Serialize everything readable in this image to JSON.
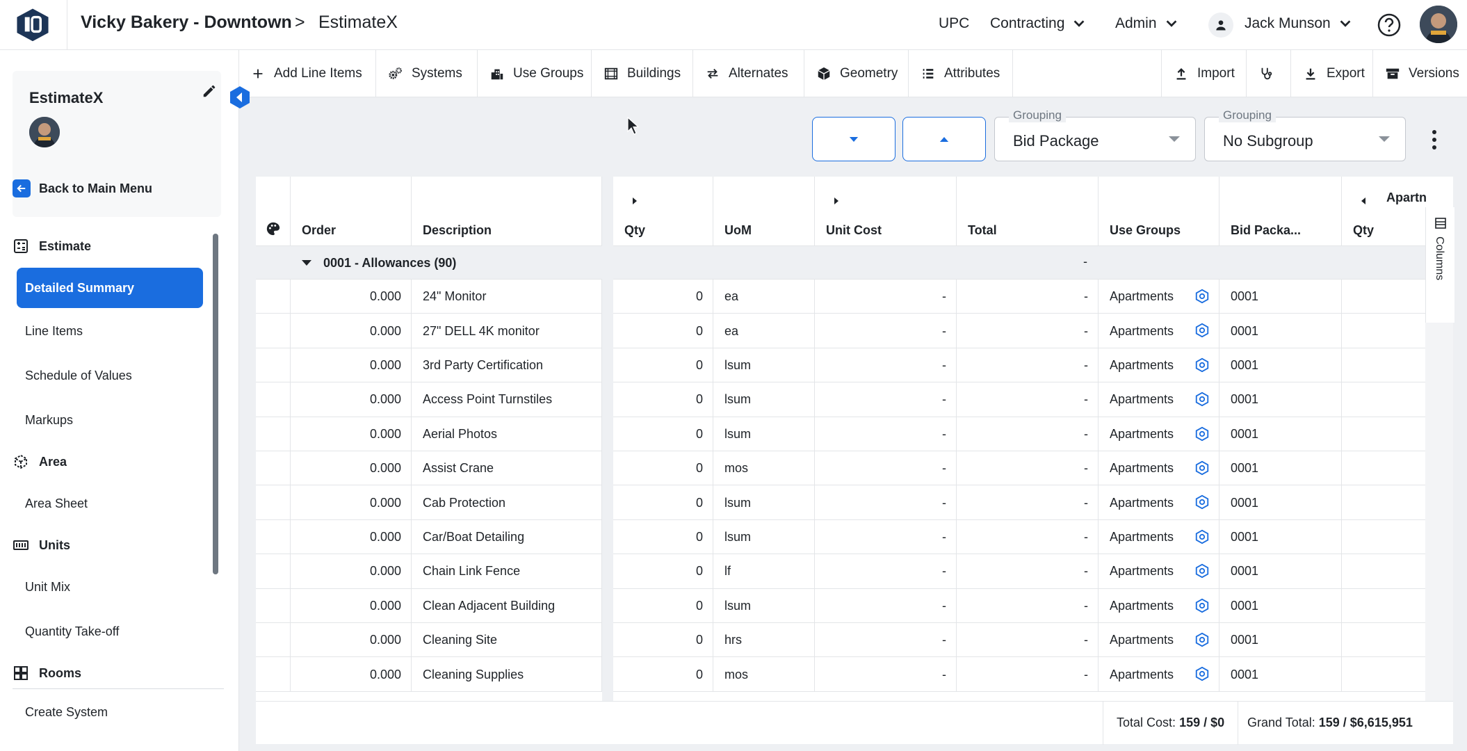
{
  "header": {
    "project_title": "Vicky Bakery - Downtown",
    "separator": ">",
    "page_title": "EstimateX",
    "nav": [
      {
        "label": "UPC"
      },
      {
        "label": "Contracting"
      },
      {
        "label": "Admin"
      }
    ],
    "user_name": "Jack Munson"
  },
  "sidebar": {
    "project_card_name": "EstimateX",
    "back_label": "Back to Main Menu",
    "sections": {
      "estimate": "Estimate",
      "area": "Area",
      "units": "Units",
      "rooms": "Rooms"
    },
    "items": {
      "detailed_summary": "Detailed Summary",
      "line_items": "Line Items",
      "schedule_of_values": "Schedule of Values",
      "markups": "Markups",
      "area_sheet": "Area Sheet",
      "unit_mix": "Unit Mix",
      "quantity_takeoff": "Quantity Take-off",
      "create_system": "Create System"
    }
  },
  "toolbar": {
    "add_line_items": "Add Line Items",
    "systems": "Systems",
    "use_groups": "Use Groups",
    "buildings": "Buildings",
    "alternates": "Alternates",
    "geometry": "Geometry",
    "attributes": "Attributes",
    "import": "Import",
    "export": "Export",
    "versions": "Versions"
  },
  "grouping": {
    "primary_label": "Grouping",
    "primary_value": "Bid Package",
    "secondary_label": "Grouping",
    "secondary_value": "No Subgroup"
  },
  "grid": {
    "columns": {
      "order": "Order",
      "description": "Description",
      "qty": "Qty",
      "uom": "UoM",
      "unit_cost": "Unit Cost",
      "total": "Total",
      "use_groups": "Use Groups",
      "bid_package": "Bid Packa...",
      "qty2": "Qty",
      "apartments_group": "Apartn"
    },
    "group_row": {
      "label": "0001 - Allowances (90)",
      "total": "-"
    },
    "rows": [
      {
        "order": "0.000",
        "description": "24\" Monitor",
        "qty": "0",
        "uom": "ea",
        "unit_cost": "-",
        "total": "-",
        "use_group": "Apartments",
        "bid_package": "0001"
      },
      {
        "order": "0.000",
        "description": "27\" DELL 4K monitor",
        "qty": "0",
        "uom": "ea",
        "unit_cost": "-",
        "total": "-",
        "use_group": "Apartments",
        "bid_package": "0001"
      },
      {
        "order": "0.000",
        "description": "3rd Party Certification",
        "qty": "0",
        "uom": "lsum",
        "unit_cost": "-",
        "total": "-",
        "use_group": "Apartments",
        "bid_package": "0001"
      },
      {
        "order": "0.000",
        "description": "Access Point Turnstiles",
        "qty": "0",
        "uom": "lsum",
        "unit_cost": "-",
        "total": "-",
        "use_group": "Apartments",
        "bid_package": "0001"
      },
      {
        "order": "0.000",
        "description": "Aerial Photos",
        "qty": "0",
        "uom": "lsum",
        "unit_cost": "-",
        "total": "-",
        "use_group": "Apartments",
        "bid_package": "0001"
      },
      {
        "order": "0.000",
        "description": "Assist Crane",
        "qty": "0",
        "uom": "mos",
        "unit_cost": "-",
        "total": "-",
        "use_group": "Apartments",
        "bid_package": "0001"
      },
      {
        "order": "0.000",
        "description": "Cab Protection",
        "qty": "0",
        "uom": "lsum",
        "unit_cost": "-",
        "total": "-",
        "use_group": "Apartments",
        "bid_package": "0001"
      },
      {
        "order": "0.000",
        "description": "Car/Boat Detailing",
        "qty": "0",
        "uom": "lsum",
        "unit_cost": "-",
        "total": "-",
        "use_group": "Apartments",
        "bid_package": "0001"
      },
      {
        "order": "0.000",
        "description": "Chain Link Fence",
        "qty": "0",
        "uom": "lf",
        "unit_cost": "-",
        "total": "-",
        "use_group": "Apartments",
        "bid_package": "0001"
      },
      {
        "order": "0.000",
        "description": "Clean Adjacent Building",
        "qty": "0",
        "uom": "lsum",
        "unit_cost": "-",
        "total": "-",
        "use_group": "Apartments",
        "bid_package": "0001"
      },
      {
        "order": "0.000",
        "description": "Cleaning Site",
        "qty": "0",
        "uom": "hrs",
        "unit_cost": "-",
        "total": "-",
        "use_group": "Apartments",
        "bid_package": "0001"
      },
      {
        "order": "0.000",
        "description": "Cleaning Supplies",
        "qty": "0",
        "uom": "mos",
        "unit_cost": "-",
        "total": "-",
        "use_group": "Apartments",
        "bid_package": "0001"
      }
    ],
    "columns_tab": "Columns"
  },
  "footer": {
    "total_cost_label": "Total Cost:",
    "total_cost_value": "159 / $0",
    "grand_total_label": "Grand Total:",
    "grand_total_value": "159 / $6,615,951"
  },
  "colors": {
    "accent": "#1a6ddf",
    "content_bg": "#eef0f3",
    "border": "#e3e5e8"
  }
}
